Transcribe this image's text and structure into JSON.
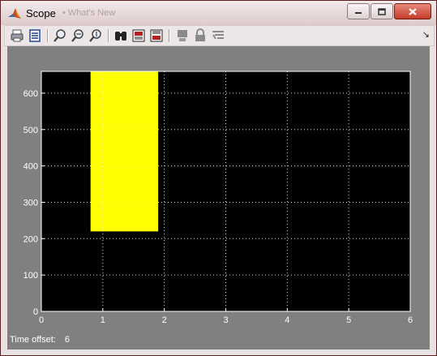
{
  "window": {
    "title": "Scope",
    "ghost_title": "• What's New",
    "controls": [
      "minimize",
      "maximize",
      "close"
    ]
  },
  "toolbar": {
    "buttons": [
      {
        "name": "print-icon"
      },
      {
        "name": "parameters-icon"
      },
      {
        "name": "zoom-icon"
      },
      {
        "name": "zoom-x-icon"
      },
      {
        "name": "zoom-y-icon"
      },
      {
        "name": "autoscale-binoculars-icon"
      },
      {
        "name": "save-axes-icon"
      },
      {
        "name": "restore-axes-icon"
      },
      {
        "name": "floating-scope-icon"
      },
      {
        "name": "lock-axes-icon"
      },
      {
        "name": "signal-selector-icon"
      }
    ],
    "dock_glyph": "↘"
  },
  "colors": {
    "plot_background": "#000000",
    "figure_background": "#808080",
    "signal": "#ffff00",
    "grid": "#ffffff",
    "axis_text": "#ffffff"
  },
  "chart_data": {
    "type": "area",
    "x": [
      0.8,
      0.8,
      1.9,
      1.9
    ],
    "y": [
      220,
      660,
      660,
      220
    ],
    "xlim": [
      0,
      6
    ],
    "ylim": [
      0,
      660
    ],
    "xticks": [
      0,
      1,
      2,
      3,
      4,
      5,
      6
    ],
    "yticks": [
      0,
      100,
      200,
      300,
      400,
      500,
      600
    ],
    "grid": true,
    "title": "",
    "xlabel": "",
    "ylabel": ""
  },
  "status": {
    "time_offset_label": "Time offset:",
    "time_offset_value": "6"
  }
}
